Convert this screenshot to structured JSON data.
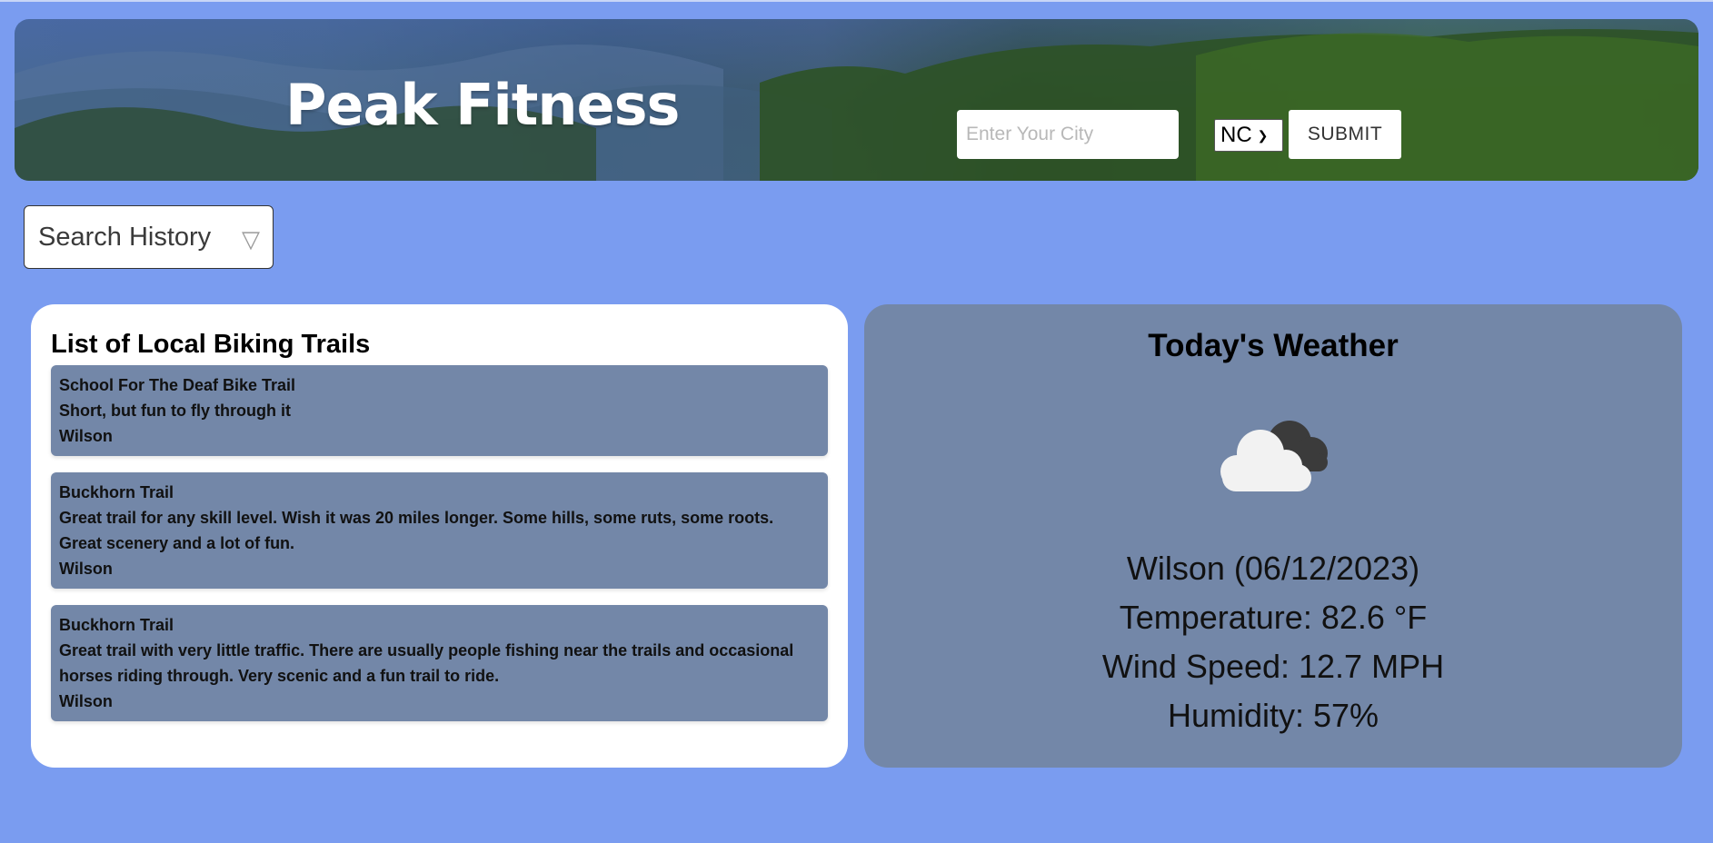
{
  "header": {
    "title": "Peak Fitness",
    "city_placeholder": "Enter Your City",
    "state_selected": "NC",
    "submit_label": "SUBMIT"
  },
  "search_history": {
    "label": "Search History"
  },
  "trails": {
    "title": "List of Local Biking Trails",
    "items": [
      {
        "name": "School For The Deaf Bike Trail",
        "description": "Short, but fun to fly through it",
        "city": "Wilson"
      },
      {
        "name": "Buckhorn Trail",
        "description": "Great trail for any skill level. Wish it was 20 miles longer. Some hills, some ruts, some roots. Great scenery and a lot of fun.",
        "city": "Wilson"
      },
      {
        "name": "Buckhorn Trail",
        "description": "Great trail with very little traffic. There are usually people fishing near the trails and occasional horses riding through. Very scenic and a fun trail to ride.",
        "city": "Wilson"
      }
    ]
  },
  "weather": {
    "title": "Today's Weather",
    "icon": "cloudy-icon",
    "city_date": "Wilson (06/12/2023)",
    "temperature": "Temperature: 82.6 °F",
    "wind": "Wind Speed: 12.7 MPH",
    "humidity": "Humidity: 57%"
  },
  "colors": {
    "page_bg": "#7a9cf0",
    "card_bg": "#7387a8",
    "panel_bg": "#ffffff"
  }
}
